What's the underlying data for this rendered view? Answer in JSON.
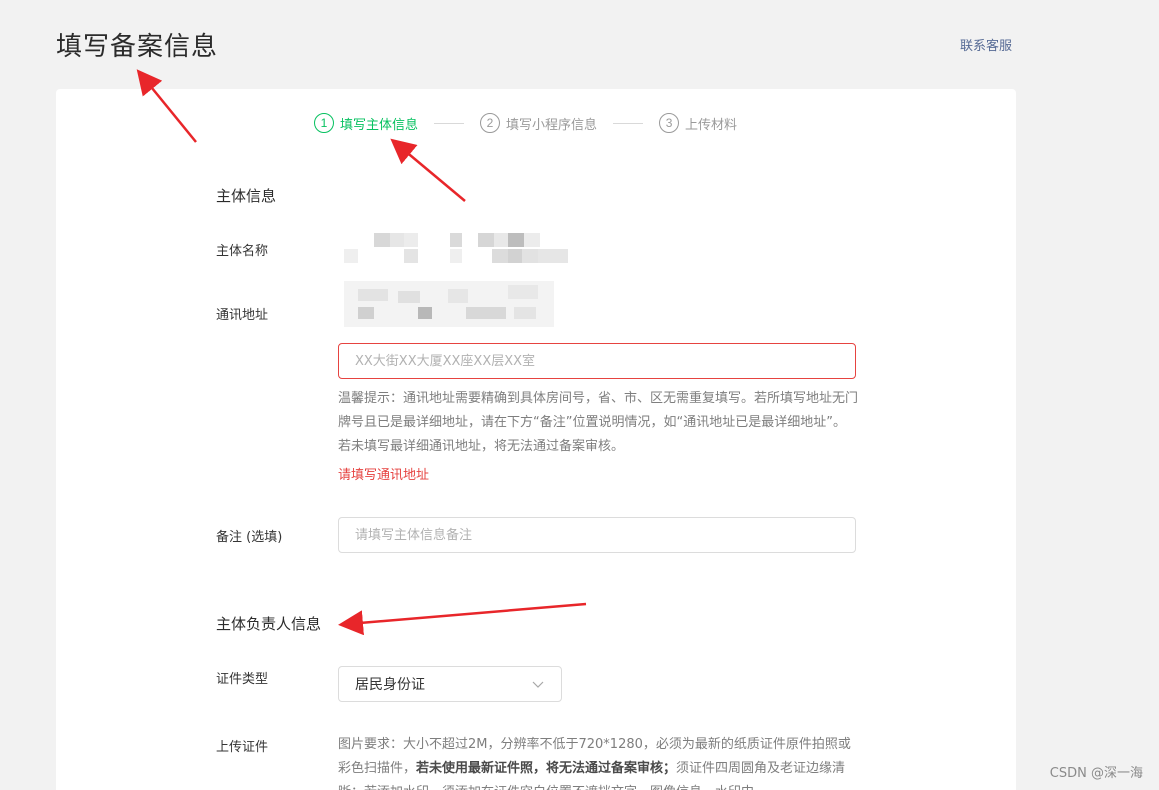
{
  "header": {
    "title": "填写备案信息",
    "contact_link": "联系客服"
  },
  "stepper": {
    "steps": [
      {
        "num": "1",
        "label": "填写主体信息",
        "active": true
      },
      {
        "num": "2",
        "label": "填写小程序信息",
        "active": false
      },
      {
        "num": "3",
        "label": "上传材料",
        "active": false
      }
    ]
  },
  "subject_info": {
    "section_title": "主体信息",
    "name_label": "主体名称",
    "address_label": "通讯地址",
    "address_input": {
      "value": "",
      "placeholder": "XX大街XX大厦XX座XX层XX室"
    },
    "address_hint": "温馨提示：通讯地址需要精确到具体房间号，省、市、区无需重复填写。若所填写地址无门牌号且已是最详细地址，请在下方“备注”位置说明情况，如“通讯地址已是最详细地址”。若未填写最详细通讯地址，将无法通过备案审核。",
    "address_error": "请填写通讯地址",
    "remark_label": "备注 (选填)",
    "remark_input": {
      "value": "",
      "placeholder": "请填写主体信息备注"
    }
  },
  "owner_info": {
    "section_title": "主体负责人信息",
    "id_type_label": "证件类型",
    "id_type_value": "居民身份证",
    "upload_label": "上传证件",
    "upload_hint_a": "图片要求：大小不超过2M，分辨率不低于720*1280，必须为最新的纸质证件原件拍照或彩色扫描件，",
    "upload_hint_bold": "若未使用最新证件照，将无法通过备案审核；",
    "upload_hint_b": "须证件四周圆角及老证边缘清晰；若添加水印，须添加在证件空白位置不遮挡文字、图像信息。水印中"
  },
  "watermark": "CSDN @深一海",
  "colors": {
    "accent_green": "#07c160",
    "error_red": "#e64340",
    "annotation_red": "#e8262a",
    "link": "#576b95"
  },
  "icons": {
    "chevron": "chevron-down-icon",
    "annotation": "red-arrow-icon"
  }
}
